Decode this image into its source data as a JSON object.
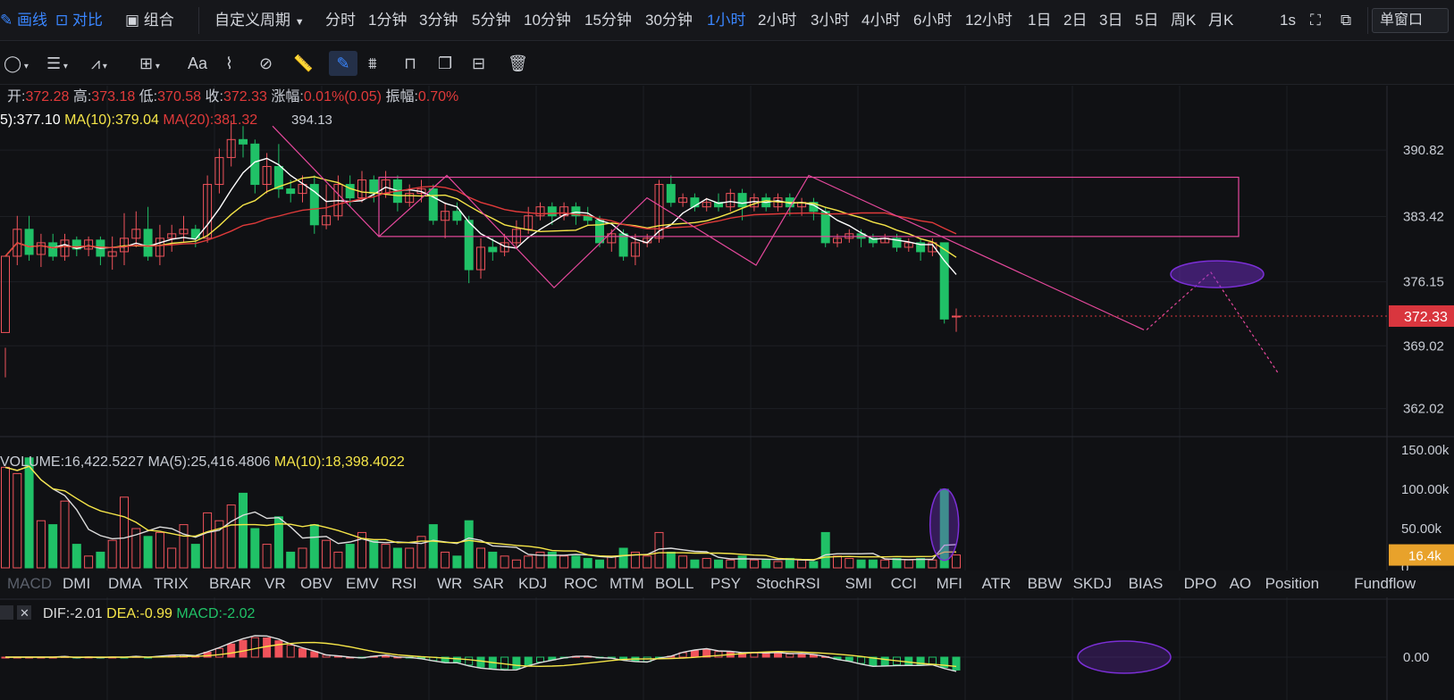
{
  "topbar": {
    "draw_label": "画线",
    "compare_label": "对比",
    "combo_label": "组合",
    "custom_period": "自定义周期",
    "periods": [
      "分时",
      "1分钟",
      "3分钟",
      "5分钟",
      "10分钟",
      "15分钟",
      "30分钟",
      "1小时",
      "2小时",
      "3小时",
      "4小时",
      "6小时",
      "12小时",
      "1日",
      "2日",
      "3日",
      "5日",
      "周K",
      "月K"
    ],
    "active_period": "1小时",
    "refresh": "1s",
    "window_mode": "单窗口"
  },
  "toolbar": {
    "tools": [
      "circle-tool-icon",
      "lines-tool-icon",
      "fib-tool-icon",
      "measure-tool-icon",
      "text-tool-icon",
      "brush-tool-icon",
      "eraser-tool-icon",
      "ruler-tool-icon",
      "pencil-tool-icon",
      "pattern-tool-icon",
      "lock-tool-icon",
      "copy-tool-icon",
      "settings-tool-icon",
      "trash-tool-icon"
    ],
    "text_tool_label": "Aa"
  },
  "info": {
    "open_label": "开:",
    "open": "372.28",
    "high_label": "高:",
    "high": "373.18",
    "low_label": "低:",
    "low": "370.58",
    "close_label": "收:",
    "close": "372.33",
    "change_label": "涨幅:",
    "change": "0.01%(0.05)",
    "amp_label": "振幅:",
    "amp": "0.70%"
  },
  "ma_legend": {
    "ma5": "5):377.10",
    "ma10": "MA(10):379.04",
    "ma20": "MA(20):381.32",
    "high_mark": "394.13"
  },
  "price_axis": {
    "ticks": [
      "390.82",
      "383.42",
      "376.15",
      "369.02",
      "362.02"
    ],
    "current": "372.33"
  },
  "volume_legend": {
    "vol": "VOLUME:16,422.5227",
    "ma5": "MA(5):25,416.4806",
    "ma10": "MA(10):18,398.4022"
  },
  "volume_axis": {
    "ticks": [
      "150.00k",
      "100.00k",
      "50.00k",
      "0"
    ],
    "current": "16.4k"
  },
  "indicator_tabs": [
    "MACD",
    "DMI",
    "DMA",
    "TRIX",
    "BRAR",
    "VR",
    "OBV",
    "EMV",
    "RSI",
    "WR",
    "SAR",
    "KDJ",
    "ROC",
    "MTM",
    "BOLL",
    "PSY",
    "StochRSI",
    "SMI",
    "CCI",
    "MFI",
    "ATR",
    "BBW",
    "SKDJ",
    "BIAS",
    "DPO",
    "AO",
    "Position",
    "Fundflow"
  ],
  "macd_legend": {
    "dif": "DIF:-2.01",
    "dea": "DEA:-0.99",
    "macd": "MACD:-2.02"
  },
  "macd_axis": {
    "zero": "0.00"
  },
  "colors": {
    "up": "#f0535b",
    "down": "#20c167",
    "ma5": "#ffffff",
    "ma10": "#f5e548",
    "ma20": "#e03a3a",
    "drawing": "#e5489c",
    "ellipse": "#7b2fd6",
    "accent": "#3a86ff",
    "vol_badge": "#e8a22b"
  },
  "chart_data": {
    "type": "candlestick",
    "timeframe": "1小时",
    "candles": [
      [
        370.5,
        379.0,
        368.8,
        365.5
      ],
      [
        379.0,
        382.0,
        383.5,
        378.0
      ],
      [
        382.0,
        379.2,
        383.5,
        378.5
      ],
      [
        379.2,
        380.5,
        381.5,
        377.8
      ],
      [
        380.5,
        379.0,
        381.5,
        378.5
      ],
      [
        379.0,
        380.8,
        381.5,
        378.5
      ],
      [
        380.8,
        379.8,
        381.2,
        379.0
      ],
      [
        379.8,
        380.8,
        381.2,
        379.0
      ],
      [
        380.8,
        379.0,
        381.2,
        378.0
      ],
      [
        379.0,
        379.5,
        381.2,
        377.5
      ],
      [
        379.5,
        381.0,
        383.8,
        378.0
      ],
      [
        381.0,
        382.0,
        384.0,
        380.0
      ],
      [
        382.0,
        379.0,
        384.5,
        378.5
      ],
      [
        379.0,
        381.0,
        382.5,
        378.0
      ],
      [
        381.0,
        381.5,
        382.5,
        379.5
      ],
      [
        381.5,
        382.0,
        383.5,
        380.5
      ],
      [
        382.0,
        381.0,
        382.5,
        380.0
      ],
      [
        381.0,
        387.0,
        388.0,
        380.5
      ],
      [
        387.0,
        390.0,
        391.0,
        386.0
      ],
      [
        390.0,
        392.0,
        394.1,
        389.0
      ],
      [
        392.0,
        391.5,
        393.5,
        390.0
      ],
      [
        391.5,
        387.0,
        392.0,
        386.0
      ],
      [
        387.0,
        389.0,
        390.5,
        386.0
      ],
      [
        389.0,
        386.5,
        391.5,
        385.5
      ],
      [
        386.5,
        386.0,
        387.5,
        385.0
      ],
      [
        386.0,
        387.0,
        388.0,
        385.0
      ],
      [
        387.0,
        382.5,
        388.0,
        381.5
      ],
      [
        382.5,
        383.5,
        387.0,
        382.0
      ],
      [
        383.5,
        387.0,
        388.0,
        383.0
      ],
      [
        387.0,
        385.5,
        388.0,
        384.5
      ],
      [
        385.5,
        387.5,
        388.5,
        385.0
      ],
      [
        387.5,
        386.0,
        388.0,
        385.0
      ],
      [
        386.0,
        387.5,
        388.5,
        385.5
      ],
      [
        387.5,
        385.0,
        388.0,
        384.0
      ],
      [
        385.0,
        386.0,
        387.0,
        384.5
      ],
      [
        386.0,
        386.5,
        387.5,
        385.0
      ],
      [
        386.5,
        383.0,
        387.0,
        382.5
      ],
      [
        383.0,
        384.0,
        385.0,
        381.0
      ],
      [
        384.0,
        383.0,
        385.0,
        382.5
      ],
      [
        383.0,
        377.5,
        383.5,
        376.0
      ],
      [
        377.5,
        380.0,
        381.0,
        376.5
      ],
      [
        380.0,
        379.5,
        381.0,
        378.5
      ],
      [
        379.5,
        380.5,
        381.5,
        379.0
      ],
      [
        380.5,
        382.0,
        383.0,
        380.0
      ],
      [
        382.0,
        383.5,
        384.5,
        381.5
      ],
      [
        383.5,
        384.5,
        385.0,
        383.0
      ],
      [
        384.5,
        383.5,
        385.0,
        382.5
      ],
      [
        383.5,
        384.5,
        385.0,
        383.0
      ],
      [
        384.5,
        383.5,
        385.0,
        382.5
      ],
      [
        383.5,
        383.0,
        384.5,
        382.5
      ],
      [
        383.0,
        380.5,
        383.5,
        380.0
      ],
      [
        380.5,
        381.5,
        382.0,
        379.5
      ],
      [
        381.5,
        379.0,
        382.0,
        378.5
      ],
      [
        379.0,
        380.5,
        381.5,
        378.0
      ],
      [
        380.5,
        381.0,
        381.5,
        380.0
      ],
      [
        381.0,
        387.0,
        387.5,
        380.5
      ],
      [
        387.0,
        385.0,
        388.0,
        384.5
      ],
      [
        385.0,
        385.5,
        386.0,
        384.5
      ],
      [
        385.5,
        384.5,
        386.0,
        384.0
      ],
      [
        384.5,
        385.0,
        385.5,
        384.0
      ],
      [
        385.0,
        384.5,
        386.0,
        384.0
      ],
      [
        384.5,
        386.0,
        386.5,
        384.0
      ],
      [
        386.0,
        384.5,
        386.5,
        383.0
      ],
      [
        384.5,
        385.5,
        386.0,
        384.0
      ],
      [
        385.5,
        384.5,
        386.0,
        384.0
      ],
      [
        384.5,
        385.5,
        386.0,
        384.0
      ],
      [
        385.5,
        384.5,
        386.0,
        383.5
      ],
      [
        384.5,
        385.0,
        385.5,
        383.5
      ],
      [
        385.0,
        384.0,
        385.5,
        383.0
      ],
      [
        384.0,
        380.5,
        384.5,
        380.0
      ],
      [
        380.5,
        381.0,
        381.5,
        380.0
      ],
      [
        381.0,
        381.5,
        382.0,
        380.5
      ],
      [
        381.5,
        381.0,
        382.0,
        380.0
      ],
      [
        381.0,
        380.5,
        381.5,
        380.0
      ],
      [
        380.5,
        381.0,
        381.5,
        380.5
      ],
      [
        381.0,
        380.0,
        381.5,
        379.5
      ],
      [
        380.0,
        380.5,
        381.0,
        379.5
      ],
      [
        380.5,
        379.5,
        381.0,
        378.5
      ],
      [
        379.5,
        380.5,
        381.0,
        379.0
      ],
      [
        380.5,
        372.0,
        380.5,
        371.5
      ],
      [
        372.28,
        372.33,
        373.18,
        370.58
      ]
    ],
    "volume_max": 150000,
    "volumes": [
      128,
      120,
      140,
      60,
      55,
      85,
      30,
      15,
      20,
      35,
      90,
      50,
      40,
      45,
      25,
      55,
      30,
      70,
      60,
      80,
      95,
      50,
      30,
      65,
      20,
      25,
      55,
      35,
      20,
      30,
      45,
      35,
      30,
      25,
      25,
      40,
      55,
      20,
      15,
      60,
      25,
      20,
      15,
      10,
      15,
      20,
      20,
      15,
      15,
      12,
      10,
      15,
      25,
      20,
      15,
      45,
      20,
      15,
      10,
      12,
      10,
      10,
      15,
      10,
      10,
      8,
      12,
      10,
      8,
      45,
      15,
      12,
      10,
      10,
      10,
      12,
      10,
      12,
      10,
      100,
      16.4
    ],
    "price_range": [
      359,
      398
    ]
  }
}
